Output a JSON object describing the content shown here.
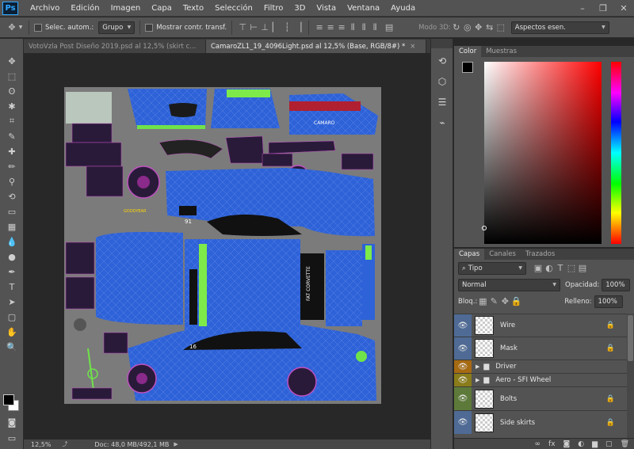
{
  "app": {
    "logo": "Ps",
    "menu": [
      "Archivo",
      "Edición",
      "Imagen",
      "Capa",
      "Texto",
      "Selección",
      "Filtro",
      "3D",
      "Vista",
      "Ventana",
      "Ayuda"
    ]
  },
  "options": {
    "auto_select_label": "Selec. autom.:",
    "auto_select_value": "Grupo",
    "transform_label": "Mostrar contr. transf.",
    "mode3d_label": "Modo 3D:",
    "workspace": "Aspectos esen."
  },
  "tabs": [
    {
      "label": "VotoVzla Post Diseño 2019.psd al 12,5% (skirt c...",
      "active": false
    },
    {
      "label": "CamaroZL1_19_4096Light.psd al 12,5% (Base, RGB/8#) *",
      "active": true
    }
  ],
  "status": {
    "zoom": "12,5%",
    "doc": "Doc: 48,0 MB/492,1 MB"
  },
  "color_panel": {
    "tabs": [
      "Color",
      "Muestras"
    ]
  },
  "layers_panel": {
    "tabs": [
      "Capas",
      "Canales",
      "Trazados"
    ],
    "filter": "Tipo",
    "blend_mode": "Normal",
    "opacity_label": "Opacidad:",
    "opacity_value": "100%",
    "lock_label": "Bloq.:",
    "fill_label": "Relleno:",
    "fill_value": "100%",
    "layers": [
      {
        "name": "Wire",
        "kind": "layer",
        "color": "#4f6b95"
      },
      {
        "name": "Mask",
        "kind": "layer",
        "color": "#4f6b95"
      },
      {
        "name": "Driver",
        "kind": "group",
        "color": "#a66a12"
      },
      {
        "name": "Aero - SFI Wheel",
        "kind": "group",
        "color": "#8a7c1a"
      },
      {
        "name": "Bolts",
        "kind": "layer",
        "color": "#5d7a3a"
      },
      {
        "name": "Side skirts",
        "kind": "layer",
        "color": "#4f6b95"
      }
    ]
  },
  "canvas_text": {
    "camaro": "CAMARO",
    "corvette": "FAT CORVETTE",
    "num1": "91",
    "num2": "16",
    "goodyear": "GOODYEAR"
  }
}
